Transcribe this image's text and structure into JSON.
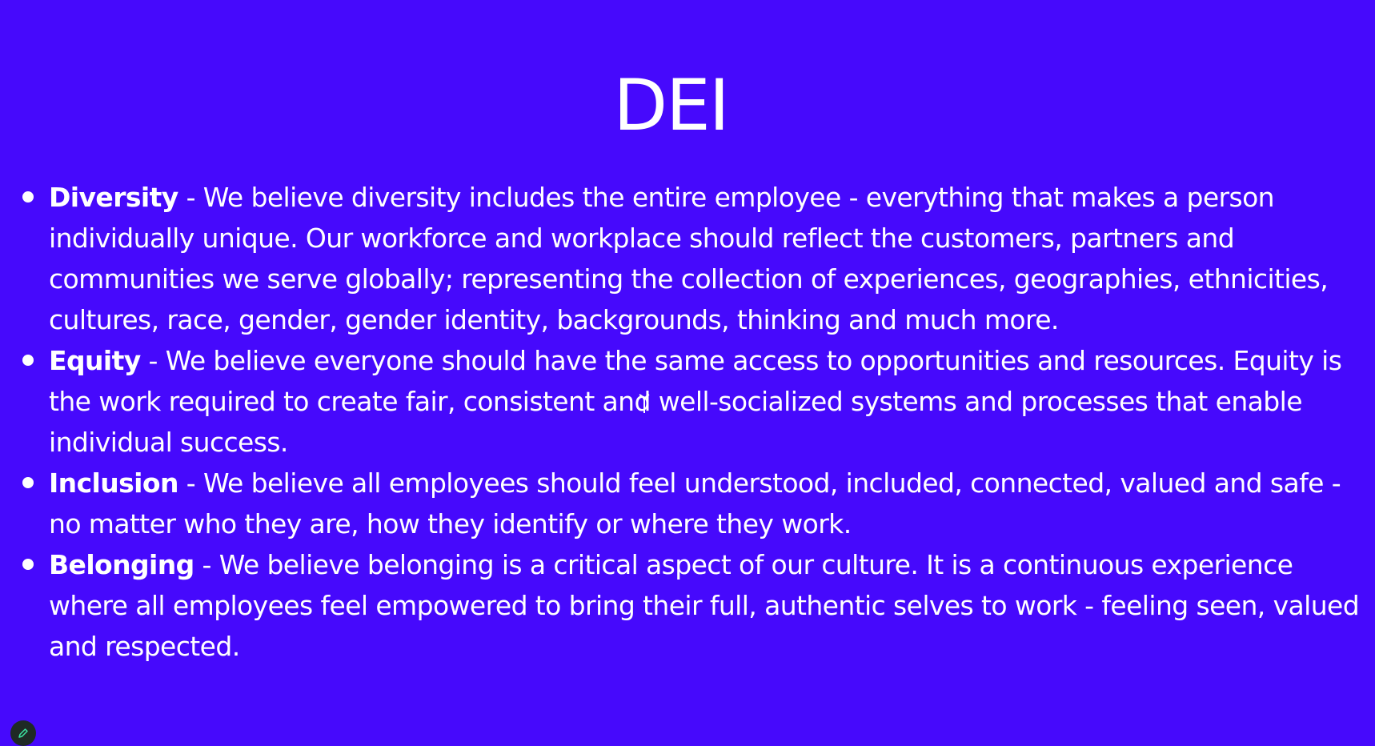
{
  "colors": {
    "background": "#4609FC",
    "text": "#FFFFFF",
    "edit_button_bg": "#1F2A25",
    "edit_button_icon": "#3CE3A0"
  },
  "slide": {
    "title": "DEI",
    "bullets": [
      {
        "term": "Diversity",
        "text": " - We believe diversity includes the entire employee - everything that makes a person individually unique. Our workforce and workplace should reflect the customers, partners and communities we serve globally; representing the collection of experiences, geographies, ethnicities, cultures, race, gender, gender identity, backgrounds, thinking and much more."
      },
      {
        "term": "Equity",
        "text": " - We believe everyone should have the same access to opportunities and resources. Equity is the work required to create fair, consistent and well-socialized systems and processes that enable individual success."
      },
      {
        "term": "Inclusion",
        "text": " - We believe all employees should feel understood, included, connected, valued and safe - no matter who they are, how they identify or where they work."
      },
      {
        "term": "Belonging",
        "text": " - We believe belonging is a critical aspect of our culture. It is a continuous experience where all employees feel empowered to bring their full, authentic selves to work - feeling seen, valued and respected."
      }
    ]
  },
  "icons": {
    "cursor": "text-cursor-icon",
    "edit": "pencil-icon"
  }
}
